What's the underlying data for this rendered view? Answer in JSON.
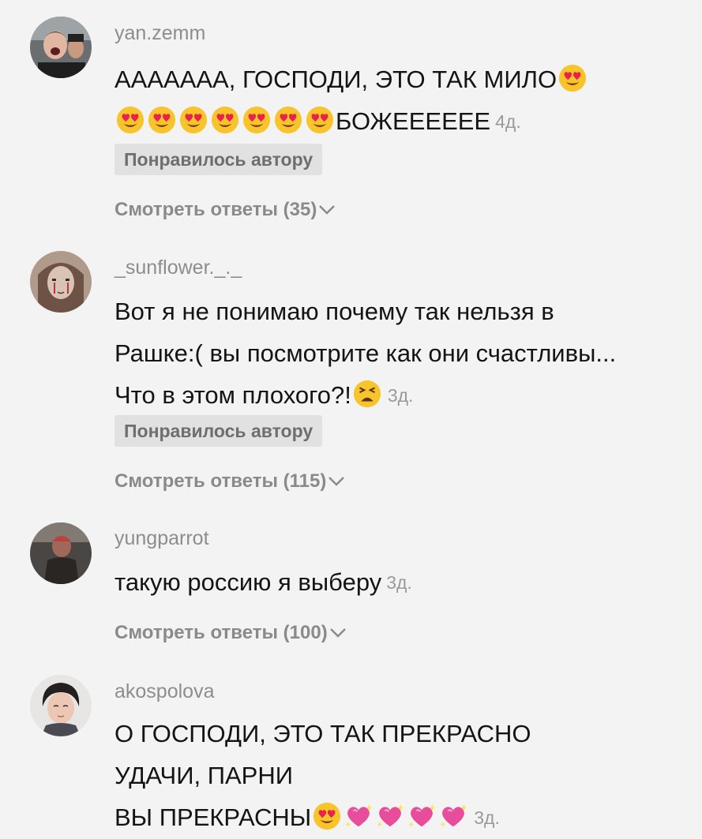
{
  "colors": {
    "background": "#f3f3f3",
    "username": "#8d8d8d",
    "text": "#141414",
    "time": "#9a9a9a",
    "liked_badge_bg": "#e1e1e1",
    "replies": "#8a8a8a"
  },
  "comments": [
    {
      "username": "yan.zemm",
      "lines": [
        "АААААAА, ГОСПОДИ, ЭТО ТАК МИЛО",
        "БОЖЕЕЕЕЕЕ"
      ],
      "time": "4д.",
      "liked_by_author": "Понравилось автору",
      "replies": "Смотреть ответы (35)",
      "emojis": [
        "heart-eyes-emoji",
        "heart-eyes-emoji",
        "heart-eyes-emoji",
        "heart-eyes-emoji",
        "heart-eyes-emoji",
        "heart-eyes-emoji",
        "heart-eyes-emoji",
        "heart-eyes-emoji"
      ]
    },
    {
      "username": "_sunflower._._",
      "lines": [
        "Вот я не понимаю почему так нельзя в",
        "Рашке:( вы посмотрите как они счастливы...",
        "Что в этом плохого?!"
      ],
      "time": "3д.",
      "liked_by_author": "Понравилось автору",
      "replies": "Смотреть ответы (115)",
      "emojis": [
        "tired-face-emoji"
      ]
    },
    {
      "username": "yungparrot",
      "lines": [
        "такую россию я выберу"
      ],
      "time": "3д.",
      "replies": "Смотреть ответы (100)"
    },
    {
      "username": "akospolova",
      "lines": [
        "О ГОСПОДИ, ЭТО ТАК ПРЕКРАСНО",
        "УДАЧИ, ПАРНИ",
        "ВЫ ПРЕКРАСНЫ"
      ],
      "time": "3д.",
      "emojis": [
        "heart-eyes-emoji",
        "sparkling-heart-emoji",
        "sparkling-heart-emoji",
        "sparkling-heart-emoji",
        "sparkling-heart-emoji"
      ]
    }
  ]
}
